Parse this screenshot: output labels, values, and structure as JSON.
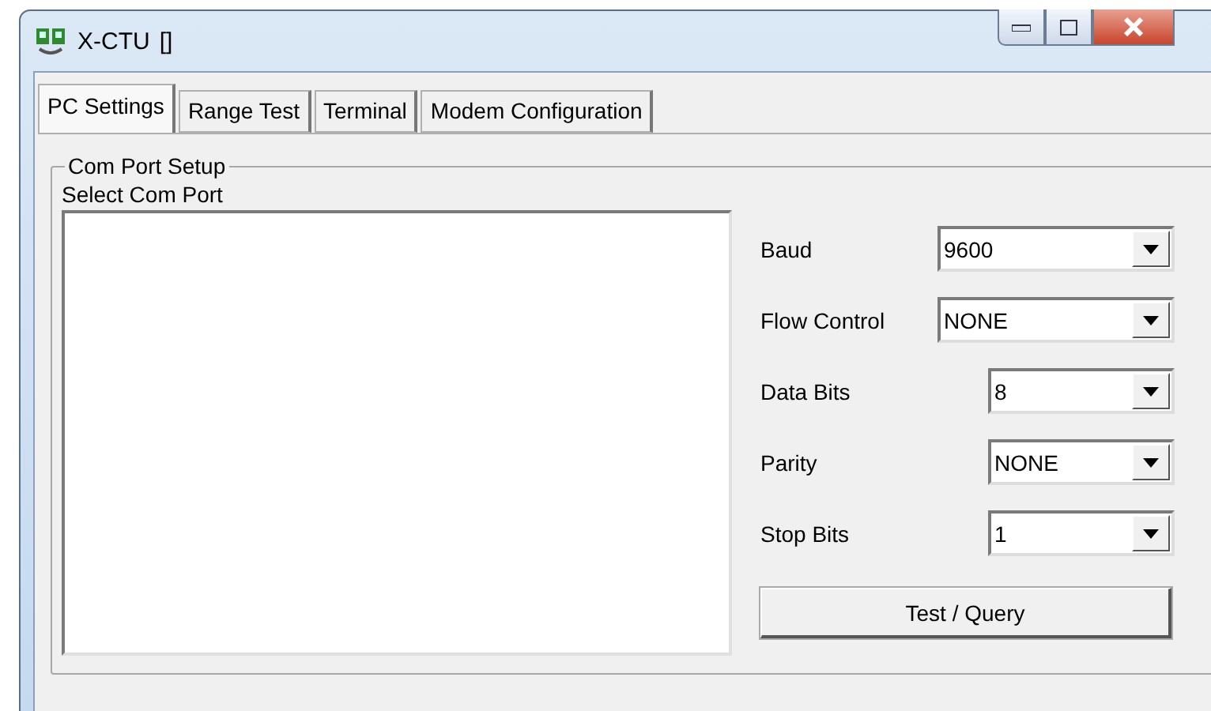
{
  "window": {
    "title": "X-CTU",
    "title_suffix": "[]"
  },
  "tabs": [
    {
      "label": "PC Settings",
      "selected": true
    },
    {
      "label": "Range Test",
      "selected": false
    },
    {
      "label": "Terminal",
      "selected": false
    },
    {
      "label": "Modem Configuration",
      "selected": false
    }
  ],
  "group": {
    "title": "Com Port Setup",
    "list_label": "Select Com Port"
  },
  "settings": [
    {
      "label": "Baud",
      "value": "9600",
      "kind": "wide"
    },
    {
      "label": "Flow Control",
      "value": "NONE",
      "kind": "wide"
    },
    {
      "label": "Data Bits",
      "value": "8",
      "kind": "narrow"
    },
    {
      "label": "Parity",
      "value": "NONE",
      "kind": "narrow"
    },
    {
      "label": "Stop Bits",
      "value": "1",
      "kind": "narrow"
    }
  ],
  "button": "Test  / Query"
}
